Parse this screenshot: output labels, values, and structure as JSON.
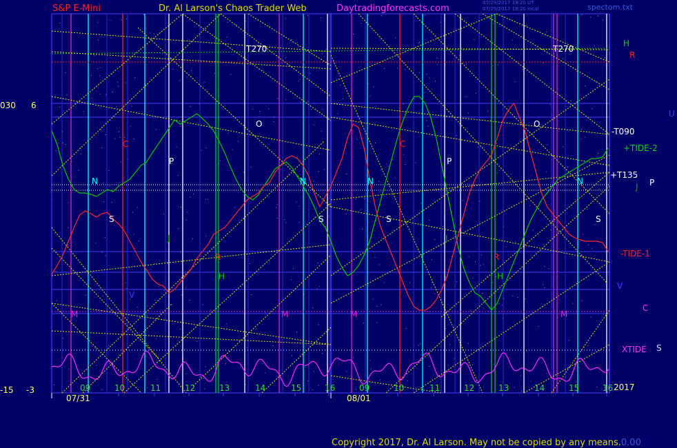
{
  "header": {
    "symbol": "S&P E-Mini",
    "site_title": "Dr. Al Larson's Chaos Trader Web",
    "site_url": "Daytradingforecasts.com",
    "stamp_line1": "07/29/2017 19:20 UT",
    "stamp_line2": "07/29/2017 19:20 local",
    "file": "spectom.txt"
  },
  "left_axis": {
    "top_a": "030",
    "top_b": "6",
    "bot_a": "-15",
    "bot_b": "-3"
  },
  "right_labels": {
    "h": "H",
    "r": "R",
    "u": "U",
    "t090": "-T090",
    "tide2": "+TIDE-2",
    "t135": "+T135",
    "j": "J",
    "p": "P",
    "tide1": "-TIDE-1",
    "v": "V",
    "c": "C",
    "xtide": "XTIDE",
    "s": "S",
    "year": "2017"
  },
  "footer": {
    "copyright": "Copyright 2017, Dr. Al Larson. May not be copied by any means.",
    "tail": "0.00"
  },
  "colors": {
    "background": "#000066",
    "frame": "#3f3fff",
    "tide": "#00cc00",
    "price": "#ff2a2a",
    "xtide": "#ff2aff",
    "grid_yellow": "#e6e600",
    "grid_white": "#ffffff",
    "cyan": "#00ffff",
    "magenta": "#dd22dd",
    "red": "#ff2020"
  },
  "chart_data": {
    "type": "line",
    "x_tick_labels": [
      "09",
      "10",
      "11",
      "12",
      "13",
      "14",
      "15",
      "16",
      "09",
      "10",
      "11",
      "12",
      "13",
      "14",
      "15",
      "16"
    ],
    "date_labels": [
      "07/31",
      "08/01"
    ],
    "price_axis": {
      "top": "6",
      "bottom": "-3"
    },
    "planet_markers": {
      "N": [
        "N",
        "N",
        "N",
        "N"
      ],
      "S": [
        "S",
        "S",
        "S",
        "S"
      ],
      "P": [
        "P",
        "P"
      ],
      "J": [
        "J",
        "J"
      ],
      "C": [
        "C",
        "C"
      ],
      "O": [
        "O",
        "O"
      ],
      "H": [
        "H",
        "H"
      ],
      "R": [
        "R",
        "R"
      ],
      "M": [
        "M",
        "M",
        "M",
        "M"
      ],
      "V": [
        "V"
      ]
    },
    "line_labels": [
      "T270",
      "T270"
    ],
    "series": [
      {
        "name": "+TIDE-2",
        "color": "#00cc00",
        "values": [
          190,
          210,
          240,
          260,
          275,
          280,
          280,
          282,
          285,
          280,
          275,
          278,
          270,
          265,
          260,
          250,
          240,
          235,
          222,
          210,
          198,
          186,
          174,
          180,
          175,
          170,
          165,
          172,
          180,
          190,
          205,
          222,
          242,
          260,
          275,
          285,
          290,
          283,
          270,
          258,
          245,
          240,
          235,
          243,
          256,
          270,
          283,
          300,
          320,
          330,
          350,
          372,
          388,
          400,
          395,
          385,
          370,
          350,
          320,
          290,
          260,
          230,
          200,
          175,
          155,
          140,
          140,
          150,
          170,
          200,
          240,
          280,
          320,
          360,
          390,
          410,
          425,
          430,
          440,
          450,
          440,
          420,
          400,
          380,
          360,
          340,
          320,
          305,
          290,
          280,
          270,
          260,
          255,
          250,
          245,
          240,
          235,
          230,
          230,
          228,
          215
        ]
      },
      {
        "name": "-TIDE-1",
        "color": "#ff2a2a",
        "values": [
          398,
          385,
          370,
          350,
          330,
          312,
          306,
          310,
          315,
          310,
          308,
          318,
          325,
          335,
          350,
          365,
          380,
          392,
          405,
          412,
          415,
          425,
          420,
          410,
          400,
          390,
          375,
          365,
          355,
          340,
          335,
          330,
          320,
          310,
          300,
          290,
          285,
          280,
          270,
          265,
          250,
          240,
          230,
          226,
          230,
          240,
          255,
          280,
          300,
          285,
          270,
          250,
          230,
          200,
          180,
          185,
          215,
          260,
          300,
          330,
          350,
          370,
          390,
          410,
          430,
          445,
          450,
          450,
          445,
          435,
          420,
          400,
          370,
          340,
          310,
          280,
          260,
          245,
          235,
          225,
          200,
          175,
          160,
          150,
          170,
          190,
          220,
          250,
          280,
          300,
          310,
          320,
          330,
          340,
          345,
          348,
          350,
          350,
          350,
          352,
          365
        ]
      },
      {
        "name": "XTIDE",
        "color": "#ff2aff"
      }
    ]
  }
}
